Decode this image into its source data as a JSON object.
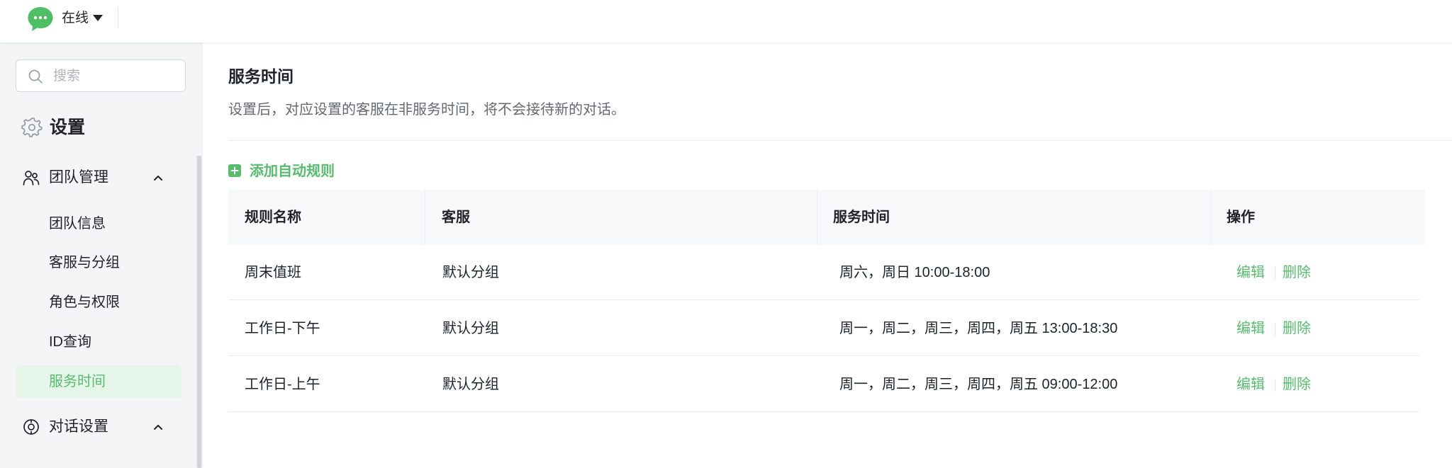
{
  "topbar": {
    "status": "在线",
    "logo_icon": "chat-bubble-icon",
    "brand_color": "#4fbf65"
  },
  "sidebar": {
    "search_placeholder": "搜索",
    "title": "设置",
    "groups": [
      {
        "label": "团队管理",
        "icon": "team-icon",
        "expanded": true,
        "items": [
          {
            "label": "团队信息",
            "active": false
          },
          {
            "label": "客服与分组",
            "active": false
          },
          {
            "label": "角色与权限",
            "active": false
          },
          {
            "label": "ID查询",
            "active": false
          },
          {
            "label": "服务时间",
            "active": true
          }
        ]
      },
      {
        "label": "对话设置",
        "icon": "chat-settings-icon",
        "expanded": true
      }
    ]
  },
  "main": {
    "title": "服务时间",
    "description": "设置后，对应设置的客服在非服务时间，将不会接待新的对话。",
    "add_rule_label": "添加自动规则",
    "table": {
      "headers": [
        "规则名称",
        "客服",
        "服务时间",
        "操作"
      ],
      "rows": [
        {
          "name": "周末值班",
          "group": "默认分组",
          "time": "周六，周日 10:00-18:00",
          "edit": "编辑",
          "delete": "删除"
        },
        {
          "name": "工作日-下午",
          "group": "默认分组",
          "time": "周一，周二，周三，周四，周五 13:00-18:30",
          "edit": "编辑",
          "delete": "删除"
        },
        {
          "name": "工作日-上午",
          "group": "默认分组",
          "time": "周一，周二，周三，周四，周五 09:00-12:00",
          "edit": "编辑",
          "delete": "删除"
        }
      ]
    }
  },
  "colors": {
    "accent": "#58bb6e",
    "active_bg": "#e6f5e9",
    "text": "#1f2329",
    "muted": "#646a73"
  }
}
